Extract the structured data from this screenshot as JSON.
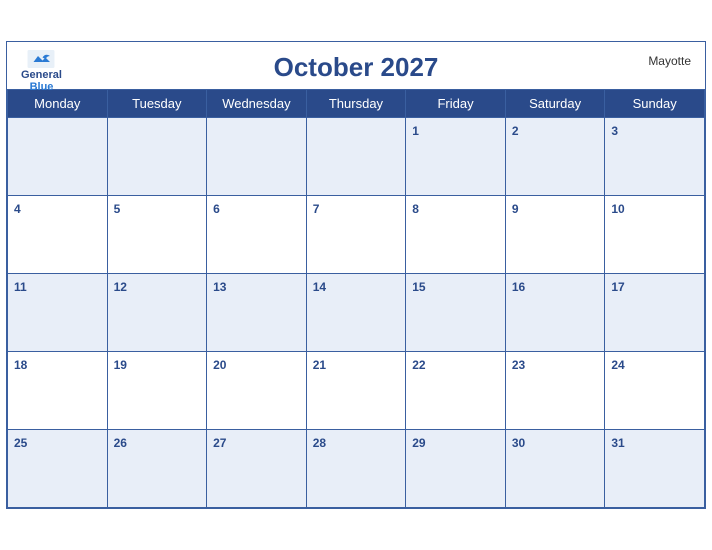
{
  "header": {
    "logo": {
      "general": "General",
      "blue": "Blue"
    },
    "title": "October 2027",
    "region": "Mayotte"
  },
  "weekdays": [
    "Monday",
    "Tuesday",
    "Wednesday",
    "Thursday",
    "Friday",
    "Saturday",
    "Sunday"
  ],
  "weeks": [
    [
      {
        "date": "",
        "empty": true
      },
      {
        "date": "",
        "empty": true
      },
      {
        "date": "",
        "empty": true
      },
      {
        "date": "",
        "empty": true
      },
      {
        "date": "1"
      },
      {
        "date": "2"
      },
      {
        "date": "3"
      }
    ],
    [
      {
        "date": "4"
      },
      {
        "date": "5"
      },
      {
        "date": "6"
      },
      {
        "date": "7"
      },
      {
        "date": "8"
      },
      {
        "date": "9"
      },
      {
        "date": "10"
      }
    ],
    [
      {
        "date": "11"
      },
      {
        "date": "12"
      },
      {
        "date": "13"
      },
      {
        "date": "14"
      },
      {
        "date": "15"
      },
      {
        "date": "16"
      },
      {
        "date": "17"
      }
    ],
    [
      {
        "date": "18"
      },
      {
        "date": "19"
      },
      {
        "date": "20"
      },
      {
        "date": "21"
      },
      {
        "date": "22"
      },
      {
        "date": "23"
      },
      {
        "date": "24"
      }
    ],
    [
      {
        "date": "25"
      },
      {
        "date": "26"
      },
      {
        "date": "27"
      },
      {
        "date": "28"
      },
      {
        "date": "29"
      },
      {
        "date": "30"
      },
      {
        "date": "31"
      }
    ]
  ],
  "colors": {
    "header_bg": "#2a4a8a",
    "stripe_bg": "#e8eef8",
    "title_color": "#2a4a8a",
    "border_color": "#3a5fa0"
  }
}
